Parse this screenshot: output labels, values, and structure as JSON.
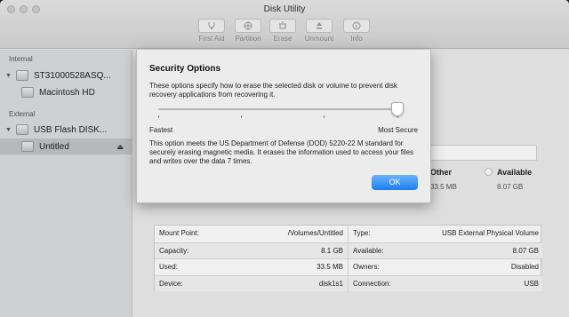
{
  "window": {
    "title": "Disk Utility"
  },
  "toolbar": {
    "first_aid": "First Aid",
    "partition": "Partition",
    "erase": "Erase",
    "unmount": "Unmount",
    "info": "Info"
  },
  "sidebar": {
    "internal_header": "Internal",
    "external_header": "External",
    "items": [
      {
        "label": "ST31000528ASQ...",
        "icon": "disk-icon"
      },
      {
        "label": "Macintosh HD",
        "icon": "volume-icon"
      },
      {
        "label": "USB Flash DISK...",
        "icon": "disk-icon"
      },
      {
        "label": "Untitled",
        "icon": "volume-icon",
        "selected": true
      }
    ]
  },
  "usage": {
    "other_label": "Other",
    "other_value": "33.5 MB",
    "available_label": "Available",
    "available_value": "8.07 GB"
  },
  "info_table": {
    "rows": [
      {
        "k1": "Mount Point:",
        "v1": "/Volumes/Untitled",
        "k2": "Type:",
        "v2": "USB External Physical Volume"
      },
      {
        "k1": "Capacity:",
        "v1": "8.1 GB",
        "k2": "Available:",
        "v2": "8.07 GB"
      },
      {
        "k1": "Used:",
        "v1": "33.5 MB",
        "k2": "Owners:",
        "v2": "Disabled"
      },
      {
        "k1": "Device:",
        "v1": "disk1s1",
        "k2": "Connection:",
        "v2": "USB"
      }
    ]
  },
  "sheet": {
    "title": "Security Options",
    "description": "These options specify how to erase the selected disk or volume to prevent disk recovery applications from recovering it.",
    "slider_min_label": "Fastest",
    "slider_max_label": "Most Secure",
    "slider_level": 1.0,
    "body": "This option meets the US Department of Defense (DOD) 5220-22 M standard for securely erasing magnetic media. It erases the information used to access your files and writes over the data 7 times.",
    "ok_label": "OK"
  },
  "colors": {
    "accent": "#1a7ef0"
  }
}
